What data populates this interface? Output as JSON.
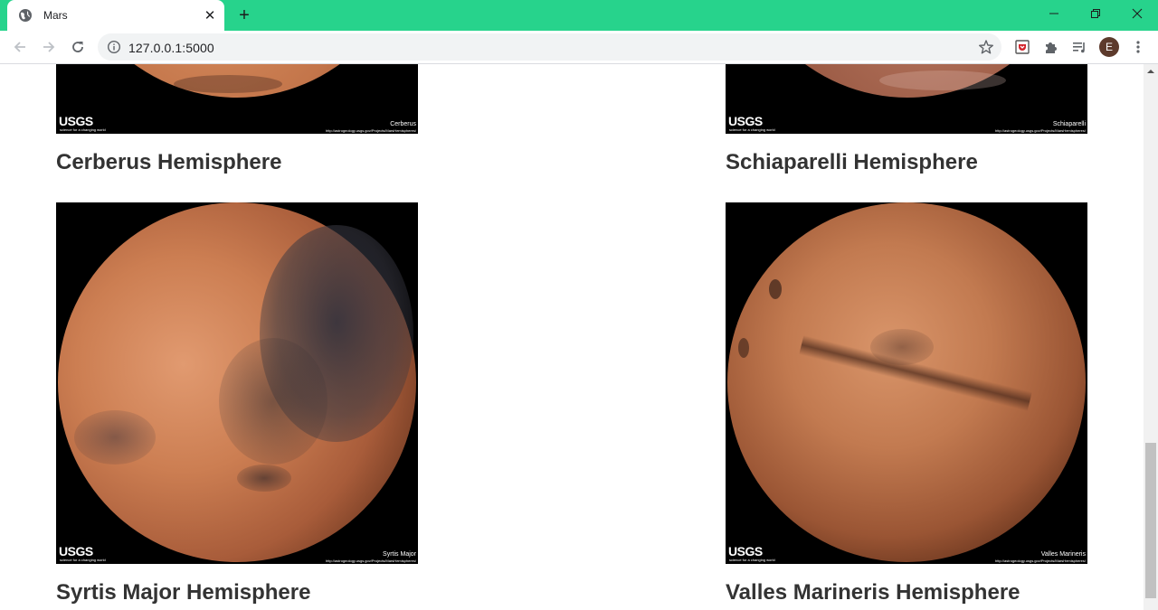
{
  "browser": {
    "tab": {
      "title": "Mars",
      "favicon": "globe-icon"
    },
    "new_tab_label": "+",
    "url": "127.0.0.1:5000",
    "profile_initial": "E",
    "colors": {
      "tabstrip": "#27d38c",
      "omnibox": "#f1f3f4",
      "avatar": "#5d3a2c"
    }
  },
  "hemispheres": [
    {
      "title": "Cerberus Hemisphere",
      "caption": "Cerberus",
      "logo": "USGS",
      "tagline": "science for a changing world",
      "source_url": "http://astrogeology.usgs.gov/Projects/MarsHemispheres/"
    },
    {
      "title": "Schiaparelli Hemisphere",
      "caption": "Schiaparelli",
      "logo": "USGS",
      "tagline": "science for a changing world",
      "source_url": "http://astrogeology.usgs.gov/Projects/MarsHemispheres/"
    },
    {
      "title": "Syrtis Major Hemisphere",
      "caption": "Syrtis Major",
      "logo": "USGS",
      "tagline": "science for a changing world",
      "source_url": "http://astrogeology.usgs.gov/Projects/MarsHemispheres/"
    },
    {
      "title": "Valles Marineris Hemisphere",
      "caption": "Valles Marineris",
      "logo": "USGS",
      "tagline": "science for a changing world",
      "source_url": "http://astrogeology.usgs.gov/Projects/MarsHemispheres/"
    }
  ],
  "colors": {
    "heading": "#333333",
    "image_bg": "#000000",
    "mars_surface": "#c97a4f"
  }
}
